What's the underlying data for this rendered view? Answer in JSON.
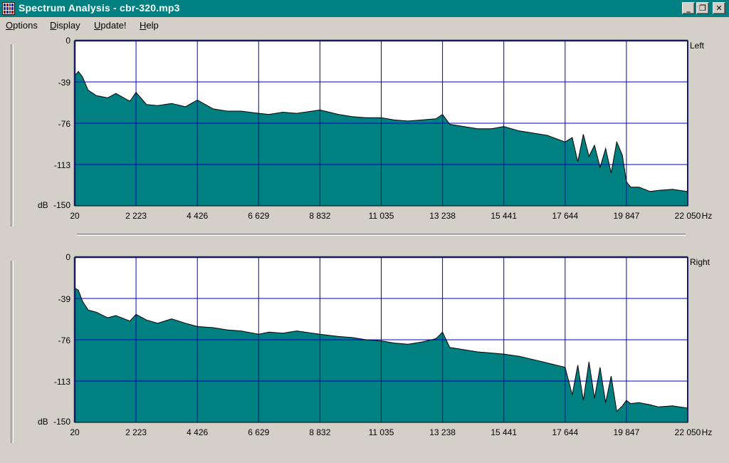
{
  "window": {
    "title": "Spectrum Analysis - cbr-320.mp3",
    "controls": {
      "minimize": "_",
      "restore": "❐",
      "close": "✕"
    }
  },
  "menu": [
    "Options",
    "Display",
    "Update!",
    "Help"
  ],
  "colors": {
    "title_bar": "#008080",
    "fill": "#008080",
    "grid": "#0000c8",
    "window_bg": "#d4d0c8"
  },
  "chart_data": [
    {
      "type": "area",
      "channel_label": "Left",
      "xlabel": "Hz",
      "ylabel": "dB",
      "x_ticks": [
        "20",
        "2 223",
        "4 426",
        "6 629",
        "8 832",
        "11 035",
        "13 238",
        "15 441",
        "17 644",
        "19 847",
        "22 050"
      ],
      "y_ticks": [
        "0",
        "-39",
        "-76",
        "-113",
        "-150"
      ],
      "xlim": [
        20,
        22050
      ],
      "ylim": [
        -150,
        0
      ],
      "grid": true,
      "x": [
        20,
        150,
        300,
        500,
        800,
        1200,
        1500,
        2000,
        2223,
        2600,
        3000,
        3500,
        4000,
        4426,
        5000,
        5500,
        6000,
        6629,
        7000,
        7500,
        8000,
        8832,
        9500,
        10000,
        10500,
        11035,
        11500,
        12000,
        12500,
        13000,
        13238,
        13500,
        14000,
        14500,
        15000,
        15441,
        16000,
        16500,
        17000,
        17644,
        17900,
        18100,
        18300,
        18500,
        18700,
        18900,
        19100,
        19300,
        19500,
        19700,
        19847,
        20000,
        20300,
        20700,
        21000,
        21500,
        22050
      ],
      "values": [
        -32,
        -28,
        -33,
        -45,
        -50,
        -52,
        -48,
        -55,
        -47,
        -58,
        -59,
        -57,
        -60,
        -54,
        -62,
        -64,
        -64,
        -66,
        -67,
        -65,
        -66,
        -63,
        -67,
        -69,
        -70,
        -70,
        -72,
        -73,
        -72,
        -71,
        -67,
        -76,
        -78,
        -80,
        -80,
        -78,
        -82,
        -84,
        -86,
        -92,
        -88,
        -110,
        -85,
        -105,
        -95,
        -115,
        -98,
        -120,
        -92,
        -104,
        -128,
        -133,
        -133,
        -137,
        -136,
        -135,
        -137
      ]
    },
    {
      "type": "area",
      "channel_label": "Right",
      "xlabel": "Hz",
      "ylabel": "dB",
      "x_ticks": [
        "20",
        "2 223",
        "4 426",
        "6 629",
        "8 832",
        "11 035",
        "13 238",
        "15 441",
        "17 644",
        "19 847",
        "22 050"
      ],
      "y_ticks": [
        "0",
        "-39",
        "-76",
        "-113",
        "-150"
      ],
      "xlim": [
        20,
        22050
      ],
      "ylim": [
        -150,
        0
      ],
      "grid": true,
      "x": [
        20,
        150,
        300,
        500,
        800,
        1200,
        1500,
        2000,
        2223,
        2600,
        3000,
        3500,
        4000,
        4426,
        5000,
        5500,
        6000,
        6629,
        7000,
        7500,
        8000,
        8832,
        9500,
        10000,
        10500,
        11035,
        11500,
        12000,
        12500,
        13000,
        13238,
        13500,
        14000,
        14500,
        15000,
        15441,
        16000,
        16500,
        17000,
        17644,
        17900,
        18100,
        18300,
        18500,
        18700,
        18900,
        19100,
        19300,
        19500,
        19700,
        19847,
        20000,
        20300,
        20700,
        21000,
        21500,
        22050
      ],
      "values": [
        -28,
        -30,
        -40,
        -48,
        -50,
        -55,
        -53,
        -58,
        -52,
        -57,
        -60,
        -56,
        -60,
        -63,
        -64,
        -66,
        -67,
        -70,
        -68,
        -69,
        -67,
        -70,
        -72,
        -73,
        -75,
        -76,
        -78,
        -79,
        -77,
        -74,
        -68,
        -82,
        -84,
        -86,
        -87,
        -88,
        -90,
        -93,
        -96,
        -100,
        -125,
        -98,
        -130,
        -95,
        -128,
        -100,
        -132,
        -108,
        -140,
        -135,
        -130,
        -133,
        -132,
        -134,
        -136,
        -135,
        -137
      ]
    }
  ]
}
